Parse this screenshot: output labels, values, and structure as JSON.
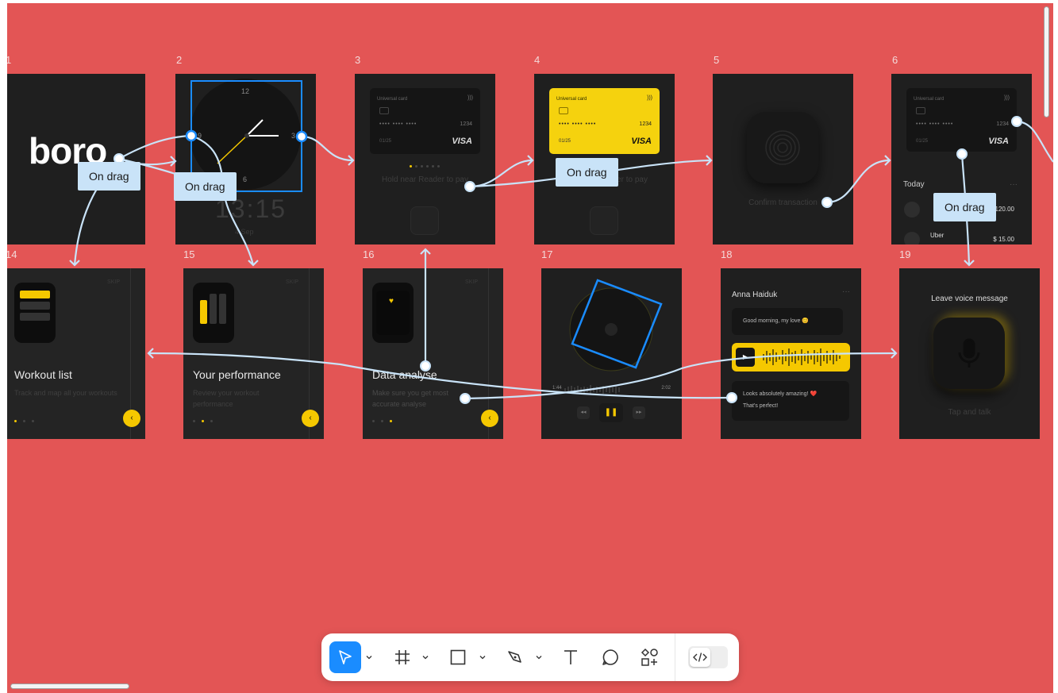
{
  "frames": {
    "numbers": [
      "1",
      "2",
      "3",
      "4",
      "5",
      "6",
      "14",
      "15",
      "16",
      "17",
      "18",
      "19"
    ],
    "logo": {
      "text": "boro"
    },
    "clock": {
      "digits": [
        "12",
        "3",
        "6",
        "9"
      ],
      "time": "13:15",
      "date": "4 Sep"
    },
    "card3": {
      "name": "Universal card",
      "dots": "••••  ••••  ••••",
      "number": "1234",
      "exp": "01/25",
      "brand": "VISA",
      "hint": "Hold near Reader to pay"
    },
    "card4": {
      "name": "Universal card",
      "dots": "••••  ••••  ••••",
      "number": "1234",
      "exp": "01/25",
      "brand": "VISA",
      "hint": "Hold near Reader to pay"
    },
    "confirm": {
      "text": "Confirm transaction"
    },
    "card6": {
      "name": "Universal card",
      "dots": "••••  ••••  ••••",
      "number": "1234",
      "exp": "01/25",
      "brand": "VISA",
      "today": "Today",
      "more": "···",
      "tx1_amount": "$ 120.00",
      "tx2_name": "Uber",
      "tx2_amount": "$ 15.00"
    },
    "workout": {
      "skip": "SKIP",
      "title": "Workout list",
      "sub": "Track and map all your workouts"
    },
    "performance": {
      "skip": "SKIP",
      "title": "Your performance",
      "sub": "Review your workout performance"
    },
    "analyse": {
      "skip": "SKIP",
      "title": "Data analyse",
      "sub": "Make sure you get most accurate analyse"
    },
    "player": {
      "start": "1:44",
      "end": "2:02"
    },
    "chat": {
      "name": "Anna Haiduk",
      "more": "···",
      "msg1": "Good morning, my love 😊",
      "msg2": "Looks absolutely amazing! ❤️",
      "msg3": "That's perfect!"
    },
    "voice": {
      "title": "Leave voice message",
      "hint": "Tap and talk"
    }
  },
  "connections": {
    "label": "On drag"
  },
  "toolbar": {
    "tools": [
      "move-tool",
      "frame-tool",
      "rectangle-tool",
      "pen-tool",
      "text-tool",
      "comment-tool",
      "components-tool"
    ],
    "dev_mode": "dev-mode-toggle",
    "accent": "#1a8cff"
  },
  "colors": {
    "canvas": "#e35555",
    "accent": "#f5c800",
    "selection": "#1a8cff",
    "connector": "#c9e3f8"
  }
}
